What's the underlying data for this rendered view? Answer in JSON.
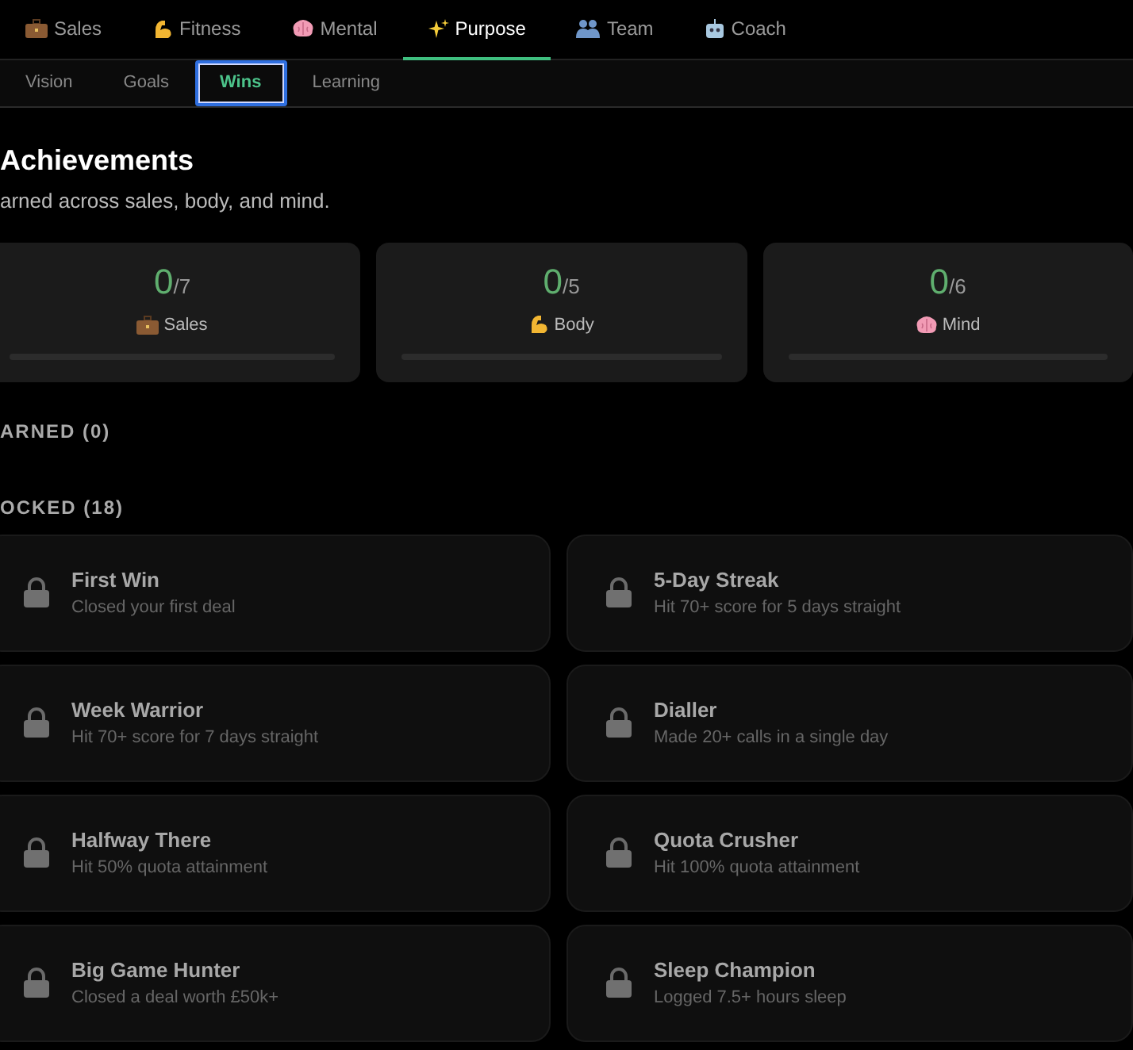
{
  "tabs": [
    {
      "label": "Sales",
      "selected": false
    },
    {
      "label": "Fitness",
      "selected": false
    },
    {
      "label": "Mental",
      "selected": false
    },
    {
      "label": "Purpose",
      "selected": true
    },
    {
      "label": "Team",
      "selected": false
    },
    {
      "label": "Coach",
      "selected": false
    }
  ],
  "subtabs": [
    {
      "label": "Vision",
      "selected": false
    },
    {
      "label": "Goals",
      "selected": false
    },
    {
      "label": "Wins",
      "selected": true
    },
    {
      "label": "Learning",
      "selected": false
    }
  ],
  "heading": "Achievements",
  "subtitle": "arned across sales, body, and mind.",
  "stats": [
    {
      "count": "0",
      "total": "/7",
      "label": "Sales",
      "level": 0
    },
    {
      "count": "0",
      "total": "/5",
      "label": "Body",
      "level": 0
    },
    {
      "count": "0",
      "total": "/6",
      "label": "Mind",
      "level": 0
    }
  ],
  "earned_heading": "ARNED (0)",
  "locked_heading": "OCKED (18)",
  "achievements": [
    {
      "title": "First Win",
      "description": "Closed your first deal",
      "locked": true
    },
    {
      "title": "5-Day Streak",
      "description": "Hit 70+ score for 5 days straight",
      "locked": true
    },
    {
      "title": "Week Warrior",
      "description": "Hit 70+ score for 7 days straight",
      "locked": true
    },
    {
      "title": "Dialler",
      "description": "Made 20+ calls in a single day",
      "locked": true
    },
    {
      "title": "Halfway There",
      "description": "Hit 50% quota attainment",
      "locked": true
    },
    {
      "title": "Quota Crusher",
      "description": "Hit 100% quota attainment",
      "locked": true
    },
    {
      "title": "Big Game Hunter",
      "description": "Closed a deal worth £50k+",
      "locked": true
    },
    {
      "title": "Sleep Champion",
      "description": "Logged 7.5+ hours sleep",
      "locked": true
    }
  ]
}
